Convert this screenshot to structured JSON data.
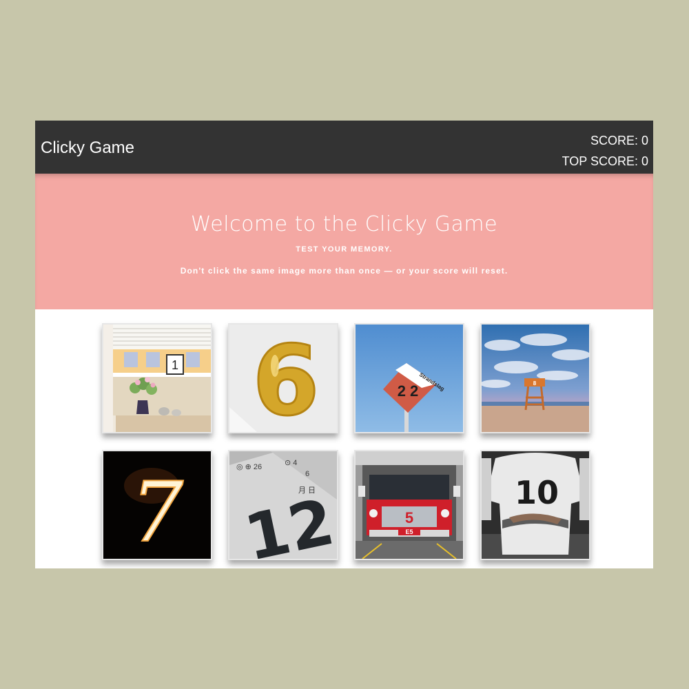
{
  "navbar": {
    "brand": "Clicky Game",
    "score_label": "SCORE: ",
    "score": 0,
    "top_score_label": "TOP SCORE: ",
    "top_score": 0
  },
  "hero": {
    "title": "Welcome to the Clicky Game",
    "tagline": "TEST YOUR MEMORY.",
    "rule": "Don't click the same image more than once — or your score will reset."
  },
  "cards": [
    {
      "number": "1",
      "subject": "window sill with flowers and number 1 sign"
    },
    {
      "number": "6",
      "subject": "gold number 6 balloon"
    },
    {
      "number": "2 2",
      "sign_text": "Strandslag",
      "subject": "beach post sign 22"
    },
    {
      "number": "8",
      "subject": "lifeguard tower on beach at dusk"
    },
    {
      "number": "7",
      "subject": "sparkler number 7 at night"
    },
    {
      "number": "12",
      "subject": "calendar pages with number 12"
    },
    {
      "number": "5",
      "plate": "E5",
      "subject": "red fire truck number 5"
    },
    {
      "number": "10",
      "subject": "soccer player jersey number 10"
    }
  ],
  "colors": {
    "page_bg": "#c7c6aa",
    "navbar_bg": "#333333",
    "hero_bg": "#f4a8a3"
  }
}
